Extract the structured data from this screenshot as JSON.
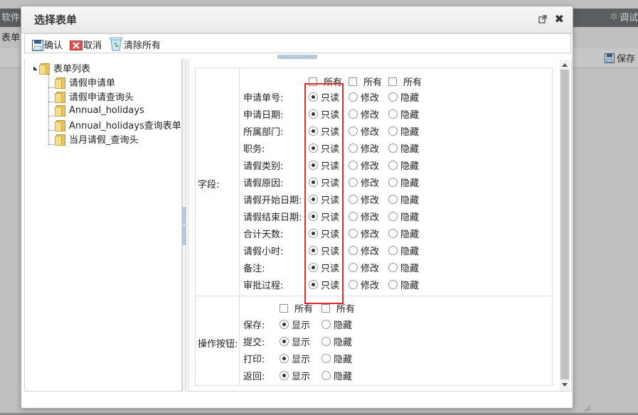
{
  "background": {
    "tab_label": "软件",
    "debug_label": "调试",
    "menu_label": "表单",
    "save_label": "保存"
  },
  "dialog": {
    "title": "选择表单",
    "toolbar": {
      "confirm": "确认",
      "cancel": "取消",
      "clear_all": "清除所有"
    }
  },
  "tree": {
    "root": "表单列表",
    "items": [
      "请假申请单",
      "请假申请查询头",
      "Annual_holidays",
      "Annual_holidays查询表单",
      "当月请假_查询头"
    ]
  },
  "form": {
    "fields_section": "字段:",
    "all_label": "所有",
    "field_rows": [
      {
        "label": "申请单号:",
        "selected": "只读"
      },
      {
        "label": "申请日期:",
        "selected": "只读"
      },
      {
        "label": "所属部门:",
        "selected": "只读"
      },
      {
        "label": "职务:",
        "selected": "只读"
      },
      {
        "label": "请假类别:",
        "selected": "只读"
      },
      {
        "label": "请假原因:",
        "selected": "只读"
      },
      {
        "label": "请假开始日期:",
        "selected": "只读"
      },
      {
        "label": "请假结束日期:",
        "selected": "只读"
      },
      {
        "label": "合计天数:",
        "selected": "只读"
      },
      {
        "label": "请假小时:",
        "selected": "只读"
      },
      {
        "label": "备注:",
        "selected": "只读"
      },
      {
        "label": "审批过程:",
        "selected": "只读"
      }
    ],
    "field_options": [
      "只读",
      "修改",
      "隐藏"
    ],
    "buttons_section": "操作按钮:",
    "button_rows": [
      {
        "label": "保存:",
        "selected": "显示"
      },
      {
        "label": "提交:",
        "selected": "显示"
      },
      {
        "label": "打印:",
        "selected": "显示"
      },
      {
        "label": "返回:",
        "selected": "显示"
      }
    ],
    "button_options": [
      "显示",
      "隐藏"
    ]
  },
  "colors": {
    "highlight": "#e32a2a",
    "accent": "#b7c7dc"
  }
}
